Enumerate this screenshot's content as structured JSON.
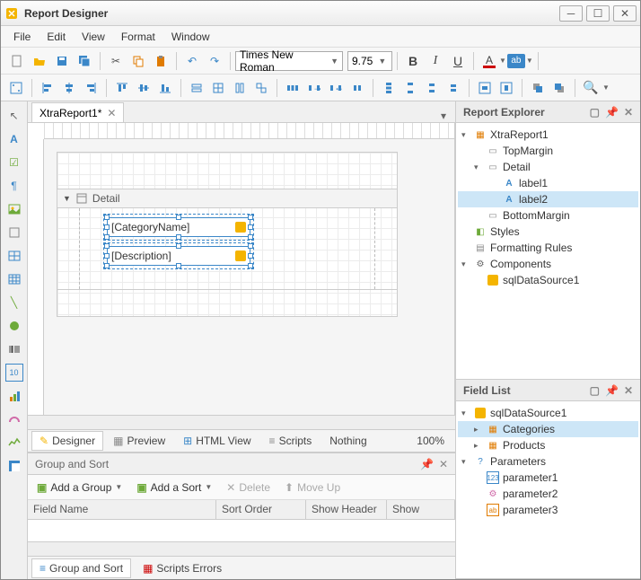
{
  "window": {
    "title": "Report Designer"
  },
  "menu": [
    "File",
    "Edit",
    "View",
    "Format",
    "Window"
  ],
  "toolbar1": {
    "font": "Times New Roman",
    "size": "9.75"
  },
  "doc_tab": "XtraReport1*",
  "section": "Detail",
  "fields": {
    "f1": "[CategoryName]",
    "f2": "[Description]"
  },
  "viewtabs": {
    "designer": "Designer",
    "preview": "Preview",
    "html": "HTML View",
    "scripts": "Scripts",
    "nothing": "Nothing",
    "zoom": "100%"
  },
  "groupsort": {
    "title": "Group and Sort",
    "addgroup": "Add a Group",
    "addsort": "Add a Sort",
    "delete": "Delete",
    "moveup": "Move Up",
    "cols": {
      "field": "Field Name",
      "order": "Sort Order",
      "header": "Show Header",
      "footer": "Show"
    }
  },
  "bottomtabs": {
    "gs": "Group and Sort",
    "se": "Scripts Errors"
  },
  "explorer": {
    "title": "Report Explorer",
    "root": "XtraReport1",
    "topmargin": "TopMargin",
    "detail": "Detail",
    "label1": "label1",
    "label2": "label2",
    "bottommargin": "BottomMargin",
    "styles": "Styles",
    "rules": "Formatting Rules",
    "components": "Components",
    "ds": "sqlDataSource1"
  },
  "fieldlist": {
    "title": "Field List",
    "ds": "sqlDataSource1",
    "categories": "Categories",
    "products": "Products",
    "params": "Parameters",
    "p1": "parameter1",
    "p2": "parameter2",
    "p3": "parameter3"
  }
}
